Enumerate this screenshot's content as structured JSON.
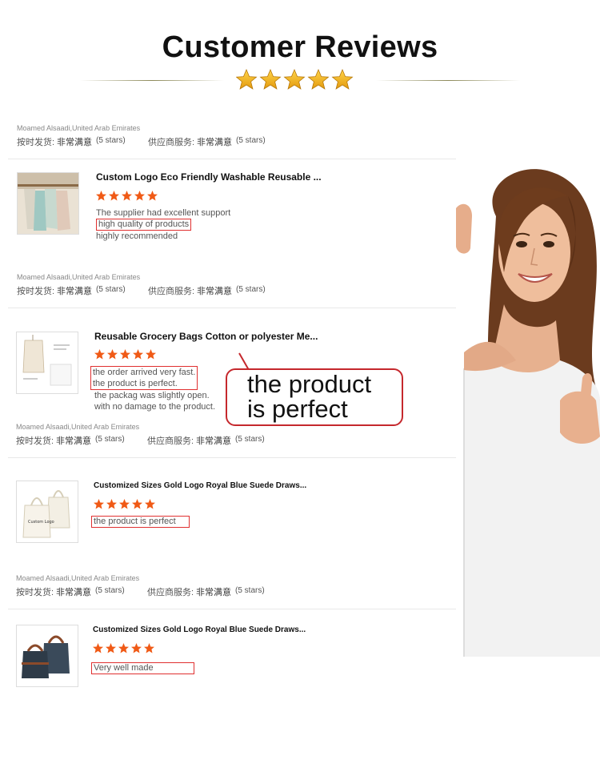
{
  "header": {
    "title": "Customer Reviews",
    "rating_stars": 5
  },
  "colors": {
    "star_orange": "#f05a16",
    "highlight_red": "#e03030",
    "gold_star": "#f6b21a"
  },
  "reviews": [
    {
      "reviewer": "Moamed Alsaadi,United Arab Emirates",
      "shipping_label": "按时发货:",
      "shipping_value": "非常满意",
      "shipping_stars": "(5 stars)",
      "service_label": "供应商服务:",
      "service_value": "非常满意",
      "service_stars": "(5 stars)",
      "product_title": "Custom Logo Eco Friendly Washable Reusable ...",
      "rating": 5,
      "lines": [
        "The supplier had excellent support",
        "high quality of products",
        "highly recommended"
      ]
    },
    {
      "reviewer": "Moamed Alsaadi,United Arab Emirates",
      "shipping_label": "按时发货:",
      "shipping_value": "非常满意",
      "shipping_stars": "(5 stars)",
      "service_label": "供应商服务:",
      "service_value": "非常满意",
      "service_stars": "(5 stars)",
      "product_title": "Reusable Grocery Bags Cotton or polyester Me...",
      "rating": 5,
      "lines": [
        "the order arrived very fast.",
        "the product is perfect.",
        "the packag was slightly open.",
        "with no damage to the product."
      ]
    },
    {
      "reviewer": "Moamed Alsaadi,United Arab Emirates",
      "shipping_label": "按时发货:",
      "shipping_value": "非常满意",
      "shipping_stars": "(5 stars)",
      "service_label": "供应商服务:",
      "service_value": "非常满意",
      "service_stars": "(5 stars)",
      "product_title": "Customized Sizes Gold Logo Royal Blue Suede Draws...",
      "rating": 5,
      "lines": [
        "the product  is perfect"
      ]
    },
    {
      "reviewer": "Moamed Alsaadi,United Arab Emirates",
      "shipping_label": "按时发货:",
      "shipping_value": "非常满意",
      "shipping_stars": "(5 stars)",
      "service_label": "供应商服务:",
      "service_value": "非常满意",
      "service_stars": "(5 stars)",
      "product_title": "Customized Sizes Gold Logo Royal Blue Suede Draws...",
      "rating": 5,
      "lines": [
        "Very well made"
      ]
    }
  ],
  "callout": {
    "line1": "the product",
    "line2": "is perfect"
  },
  "thumb_labels": {
    "tote_logo": "Custom Logo"
  }
}
